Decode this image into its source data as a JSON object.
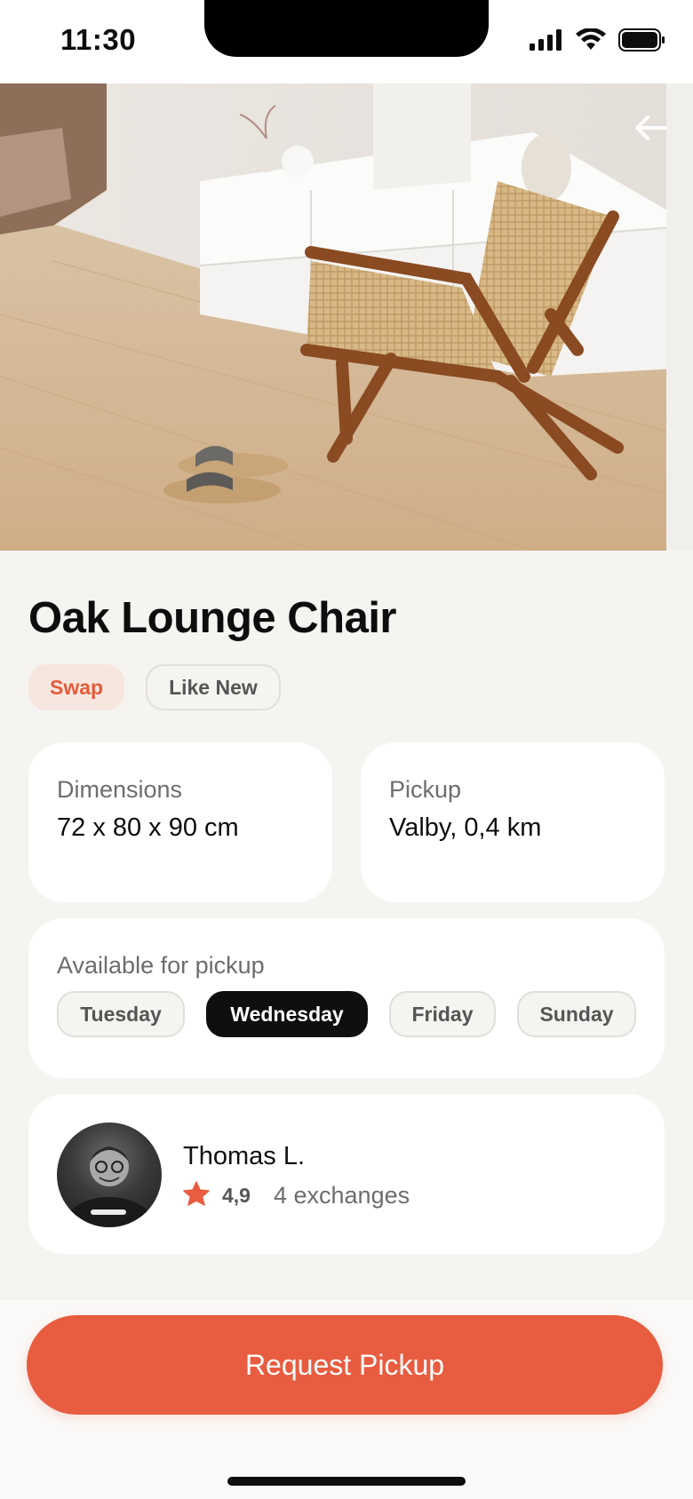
{
  "status_bar": {
    "time": "11:30",
    "icons": [
      "cellular-signal-icon",
      "wifi-icon",
      "battery-icon"
    ]
  },
  "hero": {
    "image_desc_icon": "chair-photo",
    "back_icon": "arrow-left-icon"
  },
  "listing": {
    "title": "Oak Lounge Chair",
    "tags": [
      {
        "label": "Swap",
        "color": "#e25c3b"
      },
      {
        "label": "Like New"
      }
    ]
  },
  "details": {
    "dimensions": {
      "label": "Dimensions",
      "value": "72 x 80 x 90 cm"
    },
    "pickup": {
      "label": "Pickup",
      "value": "Valby, 0,4 km"
    }
  },
  "availability": {
    "label": "Available for pickup",
    "days": [
      "Tuesday",
      "Wednesday",
      "Friday",
      "Sunday"
    ],
    "selected": "Wednesday"
  },
  "seller": {
    "name": "Thomas L.",
    "rating": "4,9",
    "exchanges": "4 exchanges",
    "star_color": "#e85c3f"
  },
  "actions": {
    "request_pickup": "Request Pickup"
  },
  "colors": {
    "accent": "#e85c3f",
    "background": "#f5f4f1",
    "dark": "#0f0f0f"
  }
}
